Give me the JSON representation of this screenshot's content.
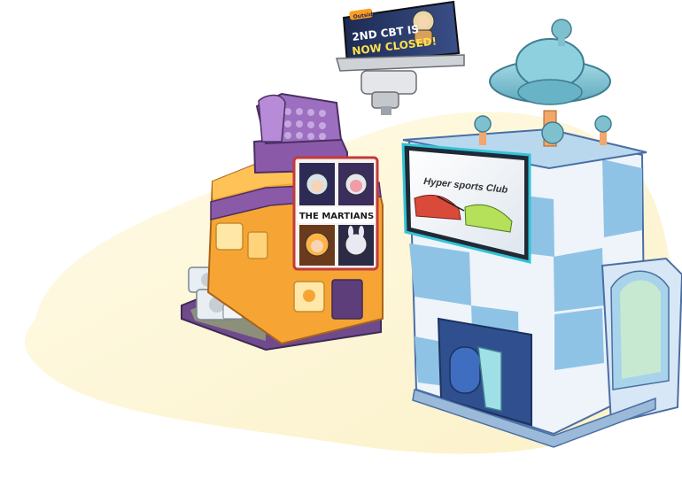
{
  "billboard": {
    "line1": "2ND CBT IS",
    "line2": "NOW CLOSED!",
    "badge_text": "Outside"
  },
  "martians_shop": {
    "sign_title": "THE MARTIANS"
  },
  "sports_club": {
    "sign_title": "Hyper sports Club"
  },
  "colors": {
    "background_blob": "#fdf6d8",
    "martians_orange": "#f6a534",
    "martians_purple": "#8a5aa8",
    "club_blue": "#8fc3e6",
    "club_white": "#eef4fa",
    "club_navy": "#2f4f8f",
    "ufo_teal": "#7fc0cf"
  },
  "icons": [
    "antenna-ball-icon",
    "ufo-dome-icon",
    "shoe-icon"
  ]
}
